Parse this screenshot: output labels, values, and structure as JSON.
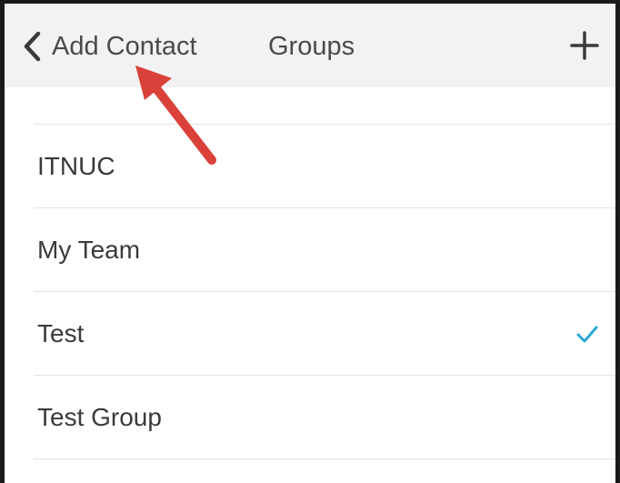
{
  "nav": {
    "back_label": "Add Contact",
    "title": "Groups",
    "back_icon": "chevron-left-icon",
    "add_icon": "plus-icon"
  },
  "groups": [
    {
      "label": "ITNUC",
      "selected": false
    },
    {
      "label": "My Team",
      "selected": false
    },
    {
      "label": "Test",
      "selected": true
    },
    {
      "label": "Test Group",
      "selected": false
    }
  ],
  "colors": {
    "accent": "#2aa7d9",
    "annotation_arrow": "#d9413a",
    "nav_bg": "#f2f2f2"
  }
}
